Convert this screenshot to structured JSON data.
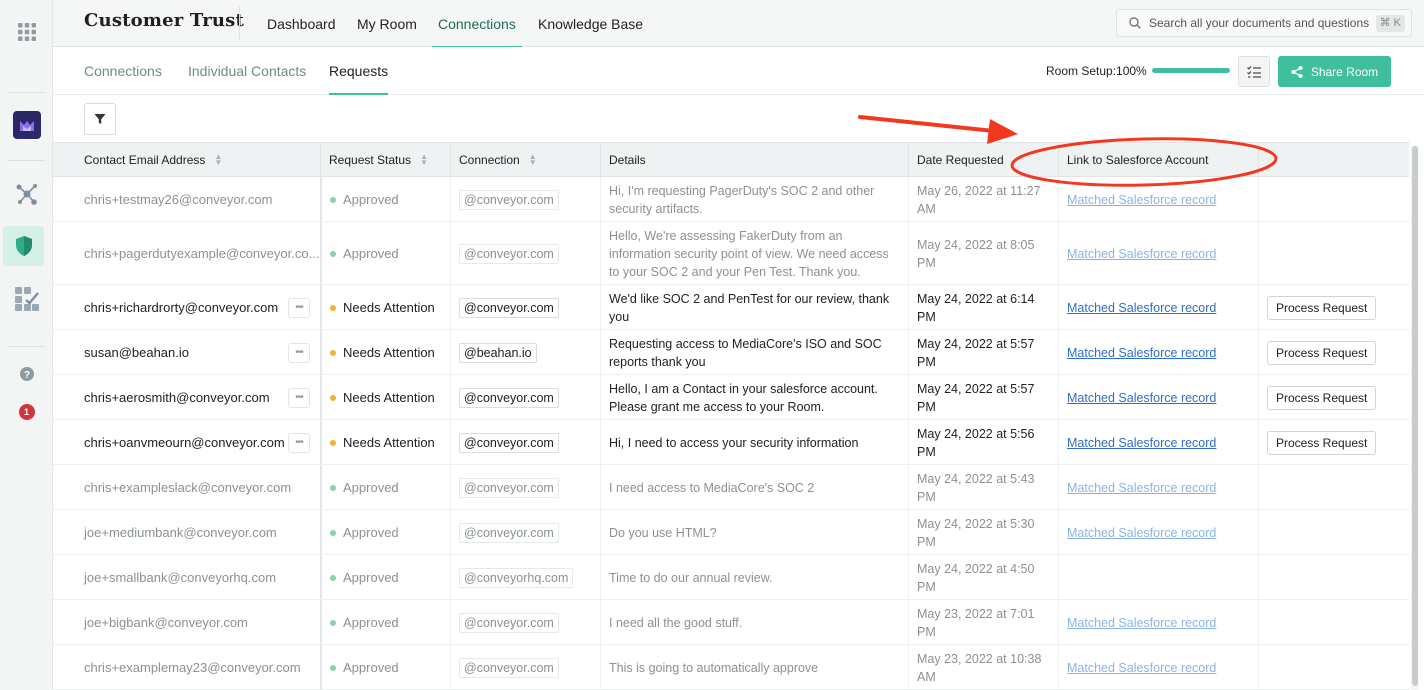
{
  "app": {
    "brand": "Customer Trust"
  },
  "nav": [
    {
      "label": "Dashboard",
      "active": false
    },
    {
      "label": "My Room",
      "active": false
    },
    {
      "label": "Connections",
      "active": true
    },
    {
      "label": "Knowledge Base",
      "active": false
    }
  ],
  "search": {
    "placeholder": "Search all your documents and questions",
    "shortcut": "⌘ K"
  },
  "subtabs": [
    {
      "label": "Connections",
      "active": false
    },
    {
      "label": "Individual Contacts",
      "active": false
    },
    {
      "label": "Requests",
      "active": true
    }
  ],
  "room_setup": {
    "label": "Room Setup:100%",
    "progress": 1.0
  },
  "share_button": "Share Room",
  "rail": {
    "notification_count": "1"
  },
  "table": {
    "columns": [
      "Contact Email Address",
      "Request Status",
      "Connection",
      "Details",
      "Date Requested",
      "Link to Salesforce Account"
    ],
    "rows": [
      {
        "email": "chris+testmay26@conveyor.com",
        "status": "Approved",
        "connection": "@conveyor.com",
        "details": "Hi, I'm requesting PagerDuty's SOC 2 and other security artifacts.",
        "date": "May 26, 2022 at 11:27 AM",
        "link": "Matched Salesforce record",
        "action": ""
      },
      {
        "email": "chris+pagerdutyexample@conveyor.co...",
        "status": "Approved",
        "connection": "@conveyor.com",
        "details": "Hello, We're assessing FakerDuty from an information security point of view. We need access to your SOC 2 and your Pen Test. Thank you.",
        "date": "May 24, 2022 at 8:05 PM",
        "link": "Matched Salesforce record",
        "action": ""
      },
      {
        "email": "chris+richardrorty@conveyor.com",
        "status": "Needs Attention",
        "connection": "@conveyor.com",
        "details": "We'd like SOC 2 and PenTest for our review, thank you",
        "date": "May 24, 2022 at 6:14 PM",
        "link": "Matched Salesforce record",
        "action": "Process Request"
      },
      {
        "email": "susan@beahan.io",
        "status": "Needs Attention",
        "connection": "@beahan.io",
        "details": "Requesting access to MediaCore's ISO and SOC reports thank you",
        "date": "May 24, 2022 at 5:57 PM",
        "link": "Matched Salesforce record",
        "action": "Process Request"
      },
      {
        "email": "chris+aerosmith@conveyor.com",
        "status": "Needs Attention",
        "connection": "@conveyor.com",
        "details": "Hello, I am a Contact in your salesforce account. Please grant me access to your Room.",
        "date": "May 24, 2022 at 5:57 PM",
        "link": "Matched Salesforce record",
        "action": "Process Request"
      },
      {
        "email": "chris+oanvmeourn@conveyor.com",
        "status": "Needs Attention",
        "connection": "@conveyor.com",
        "details": "Hi, I need to access your security information",
        "date": "May 24, 2022 at 5:56 PM",
        "link": "Matched Salesforce record",
        "action": "Process Request"
      },
      {
        "email": "chris+exampleslack@conveyor.com",
        "status": "Approved",
        "connection": "@conveyor.com",
        "details": "I need access to MediaCore's SOC 2",
        "date": "May 24, 2022 at 5:43 PM",
        "link": "Matched Salesforce record",
        "action": ""
      },
      {
        "email": "joe+mediumbank@conveyor.com",
        "status": "Approved",
        "connection": "@conveyor.com",
        "details": "Do you use HTML?",
        "date": "May 24, 2022 at 5:30 PM",
        "link": "Matched Salesforce record",
        "action": ""
      },
      {
        "email": "joe+smallbank@conveyorhq.com",
        "status": "Approved",
        "connection": "@conveyorhq.com",
        "details": "Time to do our annual review.",
        "date": "May 24, 2022 at 4:50 PM",
        "link": "",
        "action": ""
      },
      {
        "email": "joe+bigbank@conveyor.com",
        "status": "Approved",
        "connection": "@conveyor.com",
        "details": "I need all the good stuff.",
        "date": "May 23, 2022 at 7:01 PM",
        "link": "Matched Salesforce record",
        "action": ""
      },
      {
        "email": "chris+examplemay23@conveyor.com",
        "status": "Approved",
        "connection": "@conveyor.com",
        "details": "This is going to automatically approve",
        "date": "May 23, 2022 at 10:38 AM",
        "link": "Matched Salesforce record",
        "action": ""
      }
    ]
  },
  "colors": {
    "accent": "#3fbf9d",
    "approved": "#8fd0a8",
    "needs_attention": "#f0b429",
    "link": "#2f6ec8",
    "annotation": "#f2381f"
  }
}
